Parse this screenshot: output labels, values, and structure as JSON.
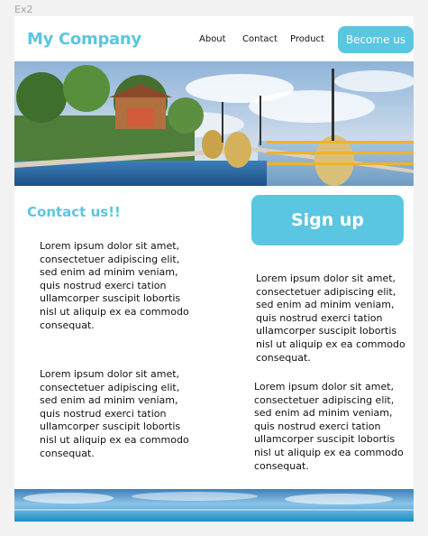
{
  "frame_label": "Ex2",
  "header": {
    "logo": "My Company",
    "nav": [
      "About",
      "Contact",
      "Product"
    ],
    "cta_label": "Become us"
  },
  "main": {
    "contact_title": "Contact us!!",
    "signup_label": "Sign up",
    "paragraphs": [
      "Lorem ipsum dolor sit amet, consectetuer adipiscing elit, sed enim ad minim veniam, quis nostrud exerci tation ullamcorper suscipit lobortis nisl ut aliquip ex ea commodo consequat.",
      "Lorem ipsum dolor sit amet, consectetuer adipiscing elit, sed enim ad minim veniam, quis nostrud exerci tation ullamcorper suscipit lobortis nisl ut aliquip ex ea commodo consequat.",
      "Lorem ipsum dolor sit amet, consectetuer adipiscing elit, sed enim ad minim veniam, quis nostrud exerci tation ullamcorper suscipit lobortis nisl ut aliquip ex ea commodo consequat.",
      "Lorem ipsum dolor sit amet, consectetuer adipiscing elit, sed enim ad minim veniam, quis nostrud exerci tation ullamcorper suscipit lobortis nisl ut aliquip ex ea commodo consequat."
    ]
  },
  "colors": {
    "accent": "#5bc6e1",
    "background": "#f2f2f2",
    "page": "#ffffff",
    "text": "#111111"
  }
}
